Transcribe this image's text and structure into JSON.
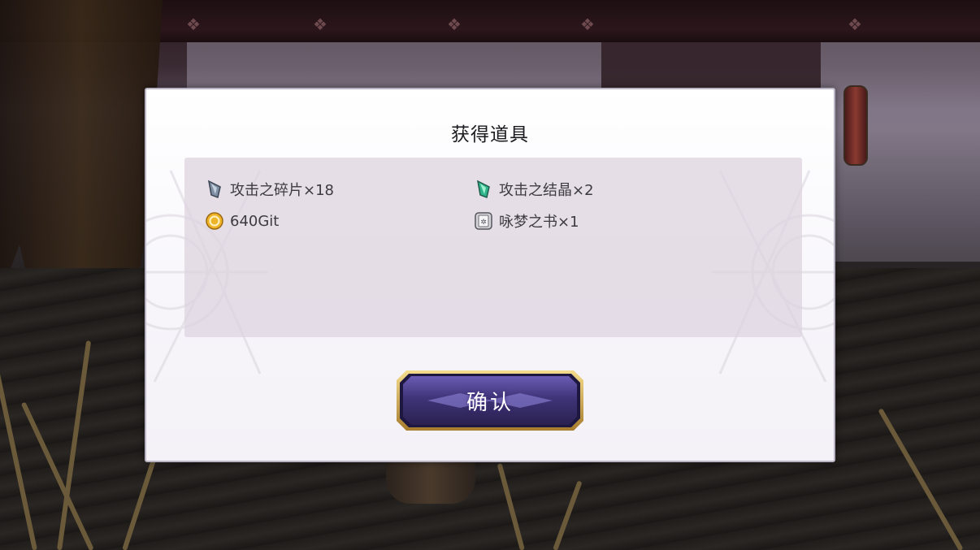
{
  "dialog": {
    "title": "获得道具",
    "confirm_label": "确认"
  },
  "rewards": [
    {
      "icon": "attack-shard-icon",
      "label": "攻击之碎片×18"
    },
    {
      "icon": "attack-crystal-icon",
      "label": "攻击之结晶×2"
    },
    {
      "icon": "gold-coin-icon",
      "label": "640Git"
    },
    {
      "icon": "dream-book-icon",
      "label": "咏梦之书×1"
    }
  ],
  "colors": {
    "button_fill": "#4b3f8a",
    "button_border": "#d8b35a",
    "panel": "#ddd3df"
  }
}
